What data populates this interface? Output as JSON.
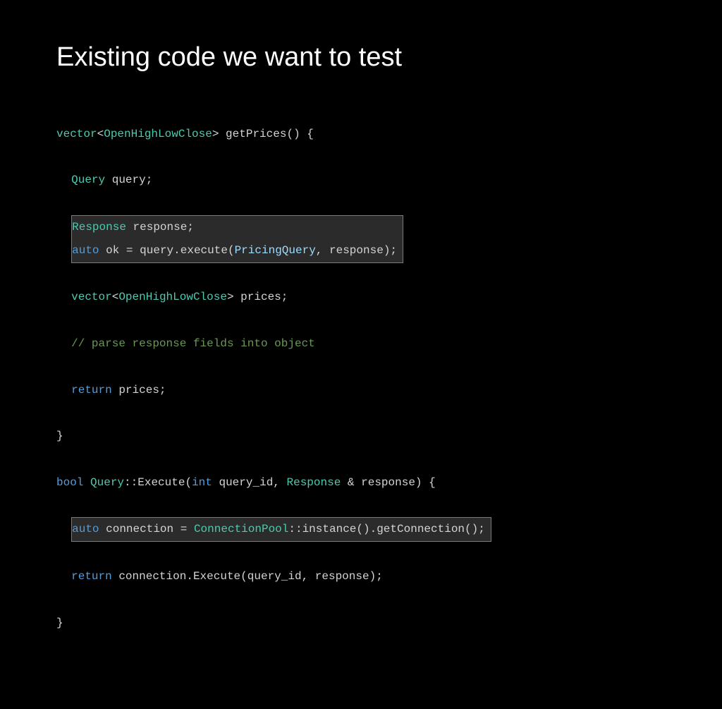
{
  "title": "Existing code we want to test",
  "code": {
    "l1": {
      "a": "vector",
      "b": "<",
      "c": "OpenHighLowClose",
      "d": "> ",
      "e": "getPrices",
      "f": "() {"
    },
    "l2": {
      "a": "Query",
      "b": " query;"
    },
    "l3": {
      "a": "Response",
      "b": " response;"
    },
    "l4": {
      "a": "auto",
      "b": " ok ",
      "c": "=",
      "d": " query.",
      "e": "execute",
      "f": "(",
      "g": "PricingQuery",
      "h": ", response);"
    },
    "l5": {
      "a": "vector",
      "b": "<",
      "c": "OpenHighLowClose",
      "d": "> prices;"
    },
    "l6": {
      "a": "// parse response fields into object"
    },
    "l7": {
      "a": "return",
      "b": " prices;"
    },
    "l8": {
      "a": "}"
    },
    "l9": {
      "a": "bool",
      "b": " ",
      "c": "Query",
      "d": "::",
      "e": "Execute",
      "f": "(",
      "g": "int",
      "h": " query_id, ",
      "i": "Response",
      "j": " & response) {"
    },
    "l10": {
      "a": "auto",
      "b": " connection ",
      "c": "=",
      "d": " ",
      "e": "ConnectionPool",
      "f": "::",
      "g": "instance",
      "h": "().",
      "i": "getConnection",
      "j": "();"
    },
    "l11": {
      "a": "return",
      "b": " connection.",
      "c": "Execute",
      "d": "(query_id, response);"
    },
    "l12": {
      "a": "}"
    }
  }
}
